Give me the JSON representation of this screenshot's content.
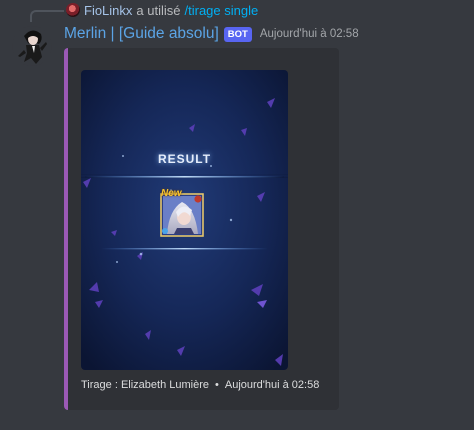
{
  "reply": {
    "username": "FioLinkx",
    "action": "a utilisé",
    "command": "/tirage single"
  },
  "message": {
    "author": "Merlin | [Guide absolu]",
    "bot_tag": "BOT",
    "timestamp": "Aujourd'hui à 02:58"
  },
  "embed": {
    "accent_color": "#9b59b6",
    "image": {
      "result_label": "RESULT",
      "new_label": "New",
      "card_icon": "character-card-icon"
    },
    "footer": {
      "text": "Tirage : Elizabeth Lumière",
      "separator": "•",
      "timestamp": "Aujourd'hui à 02:58"
    }
  },
  "colors": {
    "background": "#36393f",
    "embed_background": "#2f3136",
    "username": "#5ba4e6",
    "bot_tag": "#5865f2",
    "command": "#00b0f4"
  }
}
